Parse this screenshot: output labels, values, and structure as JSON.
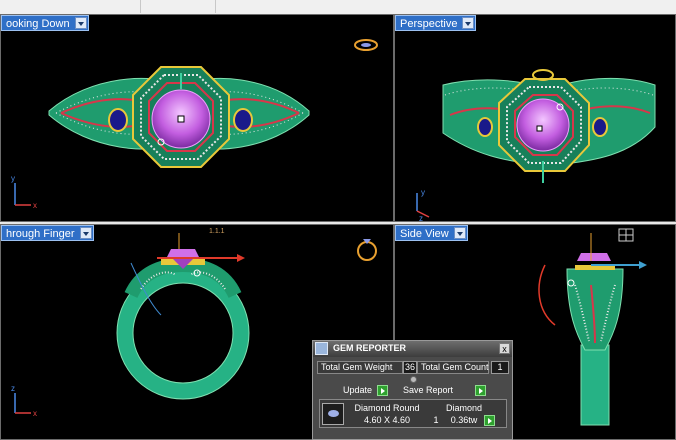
{
  "viewports": {
    "top_left": {
      "label": "ooking Down"
    },
    "top_right": {
      "label": "Perspective"
    },
    "bottom_left": {
      "label": "hrough Finger"
    },
    "bottom_right": {
      "label": "Side View"
    }
  },
  "annotations": {
    "ruler_text": "1.1.1"
  },
  "gem_reporter": {
    "title": "GEM REPORTER",
    "close": "x",
    "total_weight_label": "Total Gem Weight",
    "total_weight_value": "36",
    "total_count_label": "Total Gem Count",
    "total_count_value": "1",
    "update_label": "Update",
    "save_report_label": "Save Report",
    "gem_row": {
      "name": "Diamond Round",
      "size": "4.60 X 4.60",
      "material": "Diamond",
      "count": "1",
      "weight": "0.36tw"
    }
  },
  "colors": {
    "viewport_bg": "#000000",
    "label_bg": "#2f6fc7",
    "panel_bg": "#4a4a4a",
    "band_green": "#1ea07a",
    "gem_magenta": "#d070e8",
    "gold": "#e8c83a",
    "red_arrow": "#e03a2a"
  },
  "icons": [
    "viewport-menu-arrow-icon",
    "ring-preview-icon",
    "grid-icon",
    "gem-reporter-icon",
    "close-icon",
    "go-arrow-icon",
    "diamond-thumbnail-icon"
  ]
}
